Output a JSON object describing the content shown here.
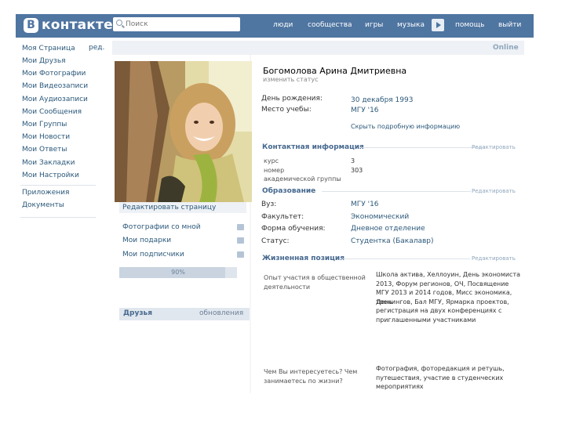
{
  "header": {
    "logo_mark": "B",
    "logo_text": "контакте",
    "search_placeholder": "Поиск",
    "nav": [
      "люди",
      "сообщества",
      "игры",
      "музыка",
      "помощь",
      "выйти"
    ]
  },
  "sidebar": {
    "edit_short": "ред.",
    "items": [
      "Моя Страница",
      "Мои Друзья",
      "Мои Фотографии",
      "Мои Видеозаписи",
      "Мои Аудиозаписи",
      "Мои Сообщения",
      "Мои Группы",
      "Мои Новости",
      "Мои Ответы",
      "Мои Закладки",
      "Мои Настройки"
    ],
    "extra_items": [
      "Приложения",
      "Документы"
    ]
  },
  "profile": {
    "online": "Online",
    "name": "Богомолова Арина Дмитриевна",
    "status_placeholder": "изменить статус",
    "birthday_label": "День рождения:",
    "birthday_value": "30 декабря 1993",
    "study_label": "Место учебы:",
    "study_value": "МГУ '16",
    "more_info": "Скрыть подробную информацию"
  },
  "left_panel": {
    "edit_page": "Редактировать страницу",
    "links": [
      "Фотографии со мной",
      "Мои подарки",
      "Мои подписчики"
    ],
    "completion_text": "90%",
    "completion": 0.9,
    "friends_label": "Друзья",
    "friends_updated": "обновления"
  },
  "contacts": {
    "title": "Контактная информация",
    "edit": "Редактировать",
    "course_label": "курс",
    "course_value": "3",
    "group_label_1": "номер",
    "group_label_2": "академической группы",
    "group_value": "303"
  },
  "education": {
    "title": "Образование",
    "edit": "Редактировать",
    "rows": [
      {
        "label": "Вуз:",
        "value": "МГУ '16"
      },
      {
        "label": "Факультет:",
        "value": "Экономический"
      },
      {
        "label": "Форма обучения:",
        "value": "Дневное отделение"
      },
      {
        "label": "Статус:",
        "value": "Студентка (Бакалавр)"
      }
    ]
  },
  "life_position": {
    "title": "Жизненная позиция",
    "edit": "Редактировать",
    "q1_line1": "Опыт участия в общественной",
    "q1_line2": "деятельности",
    "a1_lines": [
      "Школа актива, Хеллоуин, День экономиста",
      "2013, Форум регионов, ОЧ, Посвящение",
      "МГУ 2013 и 2014 годов, Мисс экономика, День",
      "тренингов, Бал МГУ, Ярмарка проектов,",
      "регистрация на двух конференциях с",
      "приглашенными участниками"
    ],
    "q2_line1": "Чем Вы интересуетесь? Чем",
    "q2_line2": "занимаетесь по жизни?",
    "a2_lines": [
      "Фотография, фоторедакция и ретушь,",
      "путешествия, участие в студенческих",
      "мероприятиях"
    ]
  }
}
